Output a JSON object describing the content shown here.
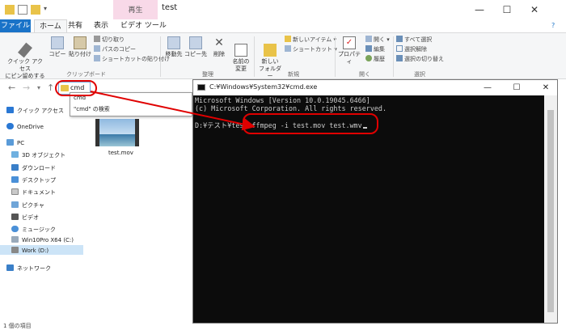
{
  "explorer": {
    "title": "test",
    "context_tab": "再生",
    "tabs": [
      "ファイル",
      "ホーム",
      "共有",
      "表示",
      "ビデオ ツール"
    ],
    "ribbon": {
      "pin_label": "クイック アクセス\nにピン留めする",
      "copy_label": "コピー",
      "paste_label": "貼り付け",
      "cut_label": "切り取り",
      "copy_path_label": "パスのコピー",
      "paste_shortcut_label": "ショートカットの貼り付け",
      "clipboard_group": "クリップボード",
      "move_to_label": "移動先",
      "copy_to_label": "コピー先",
      "delete_label": "削除",
      "rename_label": "名前の\n変更",
      "organize_group": "整理",
      "new_folder_label": "新しい\nフォルダー",
      "new_item_label": "新しいアイテム ▾",
      "shortcut_label": "ショートカット ▾",
      "new_group": "新規",
      "properties_label": "プロパティ",
      "open_label": "開く ▾",
      "edit_label": "編集",
      "history_label": "履歴",
      "open_group": "開く",
      "select_all_label": "すべて選択",
      "select_none_label": "選択解除",
      "invert_selection_label": "選択の切り替え",
      "select_group": "選択"
    },
    "address_value": "cmd",
    "autocomplete": [
      "cmd",
      "\"cmd\" の検索"
    ],
    "tree": [
      "クイック アクセス",
      "OneDrive",
      "PC",
      "3D オブジェクト",
      "ダウンロード",
      "デスクトップ",
      "ドキュメント",
      "ピクチャ",
      "ビデオ",
      "ミュージック",
      "Win10Pro X64 (C:)",
      "Work (D:)",
      "ネットワーク"
    ],
    "file_name": "test.mov",
    "status": "1 個の項目"
  },
  "cmd": {
    "title": "C:¥Windows¥System32¥cmd.exe",
    "line1": "Microsoft Windows [Version 10.0.19045.6466]",
    "line2": "(c) Microsoft Corporation. All rights reserved.",
    "prompt": "D:¥テスト¥test>ffmpeg -i test.mov test.wmv"
  },
  "colors": {
    "accent": "#1a73c8",
    "annotation": "#e00000",
    "console_bg": "#0c0c0c"
  }
}
